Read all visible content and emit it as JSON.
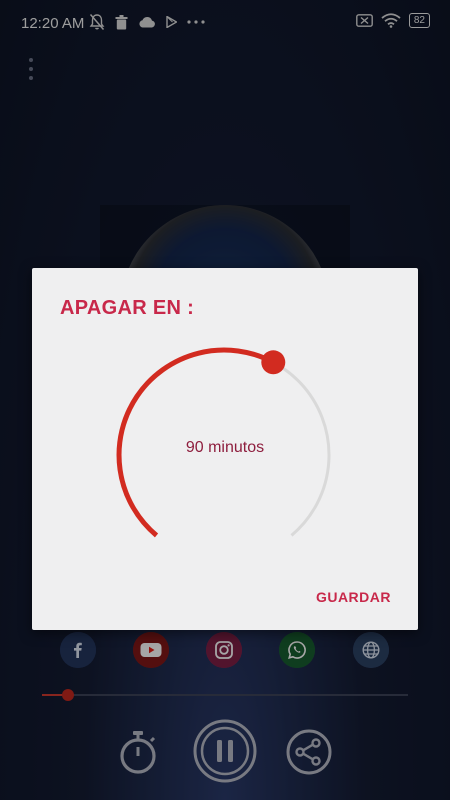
{
  "status_bar": {
    "time": "12:20 AM",
    "battery": "82",
    "left_icons": [
      "notifications-off-icon",
      "trash-icon",
      "cloud-icon",
      "play-store-icon",
      "more-dots-icon"
    ],
    "right_icons": [
      "sim-missing-icon",
      "wifi-icon",
      "battery-icon"
    ]
  },
  "dialog": {
    "title": "APAGAR EN :",
    "timer_label": "90 minutos",
    "timer_value_minutes": 90,
    "dial_fill_fraction": 0.6,
    "save_label": "GUARDAR"
  },
  "social": [
    {
      "name": "facebook",
      "icon": "facebook-icon",
      "color": "#3b5998"
    },
    {
      "name": "youtube",
      "icon": "youtube-icon",
      "color": "#e62117"
    },
    {
      "name": "instagram",
      "icon": "instagram-icon",
      "color": "#e1306c"
    },
    {
      "name": "whatsapp",
      "icon": "whatsapp-icon",
      "color": "#25a244"
    },
    {
      "name": "website",
      "icon": "globe-icon",
      "color": "#4a6fa5"
    }
  ],
  "player": {
    "progress_fraction": 0.07,
    "controls": [
      "timer-icon",
      "pause-icon",
      "share-icon"
    ]
  },
  "colors": {
    "accent": "#c8284a",
    "dial_active": "#d22b20",
    "dial_track": "#d9d9d9"
  }
}
